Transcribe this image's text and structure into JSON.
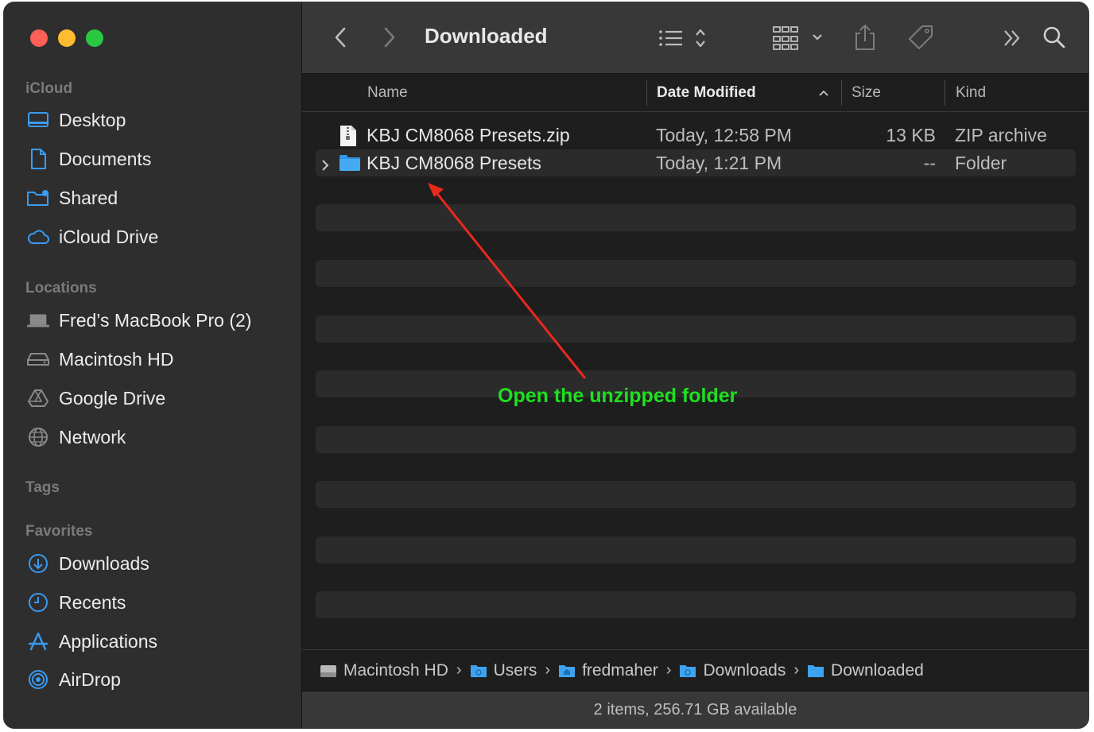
{
  "toolbar": {
    "title": "Downloaded"
  },
  "sidebar": {
    "sections": [
      {
        "label": "iCloud"
      },
      {
        "label": "Locations"
      },
      {
        "label": "Tags"
      },
      {
        "label": "Favorites"
      }
    ],
    "icloud_items": [
      {
        "label": "Desktop",
        "icon": "desktop-icon"
      },
      {
        "label": "Documents",
        "icon": "document-icon"
      },
      {
        "label": "Shared",
        "icon": "shared-folder-icon"
      },
      {
        "label": "iCloud Drive",
        "icon": "cloud-icon"
      }
    ],
    "location_items": [
      {
        "label": "Fred’s MacBook Pro (2)",
        "icon": "laptop-icon"
      },
      {
        "label": "Macintosh HD",
        "icon": "hard-drive-icon"
      },
      {
        "label": "Google Drive",
        "icon": "google-drive-icon"
      },
      {
        "label": "Network",
        "icon": "globe-icon"
      }
    ],
    "favorite_items": [
      {
        "label": "Downloads",
        "icon": "download-icon"
      },
      {
        "label": "Recents",
        "icon": "clock-icon"
      },
      {
        "label": "Applications",
        "icon": "applications-icon"
      },
      {
        "label": "AirDrop",
        "icon": "airdrop-icon"
      }
    ]
  },
  "columns": {
    "name": "Name",
    "date_modified": "Date Modified",
    "size": "Size",
    "kind": "Kind"
  },
  "files": [
    {
      "name": "KBJ CM8068 Presets.zip",
      "date": "Today, 12:58 PM",
      "size": "13 KB",
      "kind": "ZIP archive",
      "icon": "zip-file-icon"
    },
    {
      "name": "KBJ CM8068 Presets",
      "date": "Today, 1:21 PM",
      "size": "--",
      "kind": "Folder",
      "icon": "folder-icon"
    }
  ],
  "pathbar": [
    {
      "label": "Macintosh HD",
      "icon": "hard-drive-icon"
    },
    {
      "label": "Users",
      "icon": "folder-icon"
    },
    {
      "label": "fredmaher",
      "icon": "home-folder-icon"
    },
    {
      "label": "Downloads",
      "icon": "folder-icon"
    },
    {
      "label": "Downloaded",
      "icon": "folder-icon"
    }
  ],
  "status": "2 items, 256.71 GB available",
  "annotation": {
    "text": "Open the unzipped folder",
    "color": "#1fe01f",
    "arrow_color": "#e8291c"
  },
  "colors": {
    "accent": "#3a9bf0",
    "traffic_red": "#fe5f57",
    "traffic_yellow": "#febc2e",
    "traffic_green": "#28c840"
  }
}
